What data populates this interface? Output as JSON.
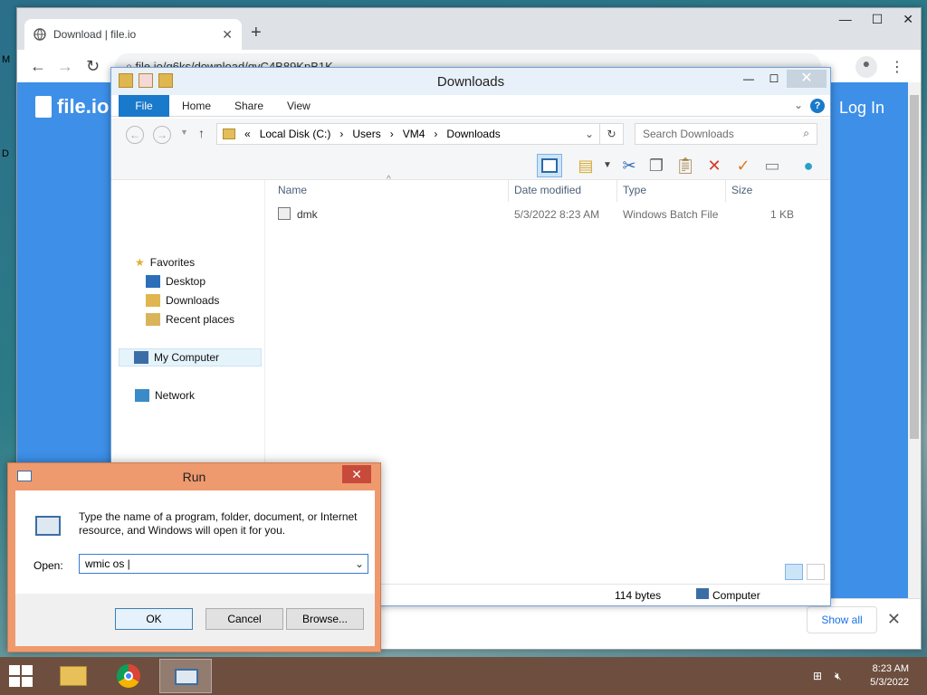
{
  "desktop": {
    "frag1": "M",
    "frag2": "D"
  },
  "browser": {
    "tab_title": "Download | file.io",
    "tab_close": "✕",
    "new_tab": "+",
    "url": "file.io/g6ks/download/qyC4B89KpB1K",
    "site_logo": "file.io",
    "login": "Log In",
    "show_all": "Show all",
    "close_bar": "✕"
  },
  "explorer": {
    "title": "Downloads",
    "ribbon_tabs": [
      "File",
      "Home",
      "Share",
      "View"
    ],
    "breadcrumb": [
      "«",
      "Local Disk (C:)",
      "›",
      "Users",
      "›",
      "VM4",
      "›",
      "Downloads"
    ],
    "search_placeholder": "Search Downloads",
    "nav": {
      "favorites": "Favorites",
      "desktop": "Desktop",
      "downloads": "Downloads",
      "recent": "Recent places",
      "my_computer": "My Computer",
      "network": "Network"
    },
    "columns": {
      "name": "Name",
      "date": "Date modified",
      "type": "Type",
      "size": "Size"
    },
    "files": [
      {
        "name": "dmk",
        "date": "5/3/2022 8:23 AM",
        "type": "Windows Batch File",
        "size": "1 KB"
      }
    ],
    "status": {
      "size": "114 bytes",
      "location": "Computer"
    }
  },
  "run": {
    "title": "Run",
    "description": "Type the name of a program, folder, document, or Internet resource, and Windows will open it for you.",
    "open_label": "Open:",
    "input_value": "wmic os ",
    "ok": "OK",
    "cancel": "Cancel",
    "browse": "Browse..."
  },
  "taskbar": {
    "time": "8:23 AM",
    "date": "5/3/2022"
  }
}
